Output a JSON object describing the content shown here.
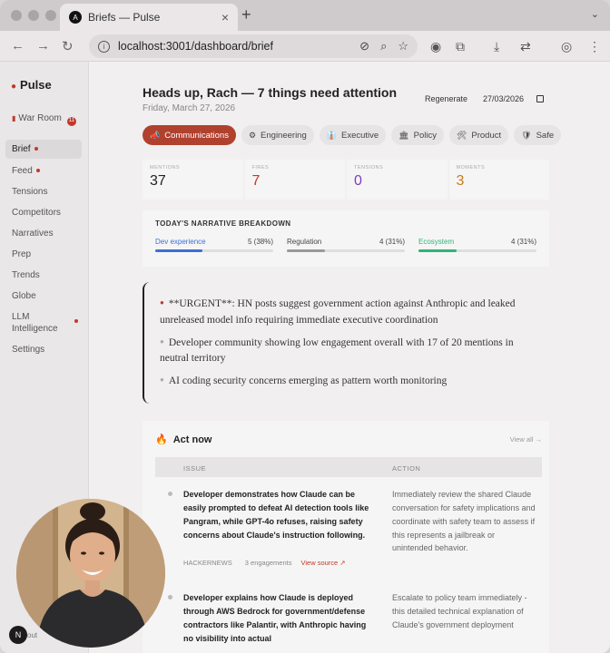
{
  "browser": {
    "tab_title": "Briefs — Pulse",
    "tab_favicon": "A",
    "url": "localhost:3001/dashboard/brief"
  },
  "sidebar": {
    "brand": "Pulse",
    "items": [
      {
        "label": "War Room",
        "icon": "red-card-icon",
        "badge": "11",
        "active": false
      },
      {
        "label": "Brief",
        "active": true,
        "dot": true
      },
      {
        "label": "Feed",
        "dot": true
      },
      {
        "label": "Tensions"
      },
      {
        "label": "Competitors"
      },
      {
        "label": "Narratives"
      },
      {
        "label": "Prep"
      },
      {
        "label": "Trends"
      },
      {
        "label": "Globe"
      },
      {
        "label": "LLM Intelligence",
        "dot": true
      },
      {
        "label": "Settings"
      }
    ],
    "footer_fragment": "out"
  },
  "header": {
    "title": "Heads up, Rach — 7 things need attention",
    "date": "Friday, March 27, 2026",
    "regenerate_label": "Regenerate",
    "date_value": "27/03/2026"
  },
  "tabs": [
    {
      "label": "Communications",
      "icon": "megaphone-icon"
    },
    {
      "label": "Engineering",
      "icon": "gear-icon"
    },
    {
      "label": "Executive",
      "icon": "briefcase-icon"
    },
    {
      "label": "Policy",
      "icon": "building-icon"
    },
    {
      "label": "Product",
      "icon": "wrench-icon"
    },
    {
      "label": "Safe",
      "icon": "shield-icon"
    }
  ],
  "stats": [
    {
      "label": "MENTIONS",
      "value": "37",
      "color": "#222222"
    },
    {
      "label": "FIRES",
      "value": "7",
      "color": "#c0392b"
    },
    {
      "label": "TENSIONS",
      "value": "0",
      "color": "#7b3fb5"
    },
    {
      "label": "MOMENTS",
      "value": "3",
      "color": "#c47a1c"
    }
  ],
  "narrative": {
    "title": "TODAY'S NARRATIVE BREAKDOWN",
    "items": [
      {
        "name": "Dev experience",
        "value": "5 (38%)",
        "share": 0.38,
        "color": "#3b6fd6"
      },
      {
        "name": "Regulation",
        "value": "4 (31%)",
        "share": 0.31,
        "color": "#9a9a9a"
      },
      {
        "name": "Ecosystem",
        "value": "4 (31%)",
        "share": 0.31,
        "color": "#2fb37a"
      }
    ]
  },
  "summary": [
    {
      "text": "**URGENT**: HN posts suggest government action against Anthropic and leaked unreleased model info requiring immediate executive coordination",
      "urgent": true
    },
    {
      "text": "Developer community showing low engagement overall with 17 of 20 mentions in neutral territory",
      "urgent": false
    },
    {
      "text": "AI coding security concerns emerging as pattern worth monitoring",
      "urgent": false
    }
  ],
  "act_now": {
    "title": "Act now",
    "icon": "fire-icon",
    "view_all": "View all →",
    "columns": [
      "ISSUE",
      "ACTION"
    ],
    "rows": [
      {
        "issue": "Developer demonstrates how Claude can be easily prompted to defeat AI detection tools like Pangram, while GPT-4o refuses, raising safety concerns about Claude's instruction following.",
        "action": "Immediately review the shared Claude conversation for safety implications and coordinate with safety team to assess if this represents a jailbreak or unintended behavior.",
        "source": "HACKERNEWS",
        "engagements": "3 engagements",
        "view_source": "View source ↗"
      },
      {
        "issue": "Developer explains how Claude is deployed through AWS Bedrock for government/defense contractors like Palantir, with Anthropic having no visibility into actual",
        "action": "Escalate to policy team immediately - this detailed technical explanation of Claude's government deployment"
      }
    ]
  },
  "overlay": {
    "n_button": "N"
  }
}
